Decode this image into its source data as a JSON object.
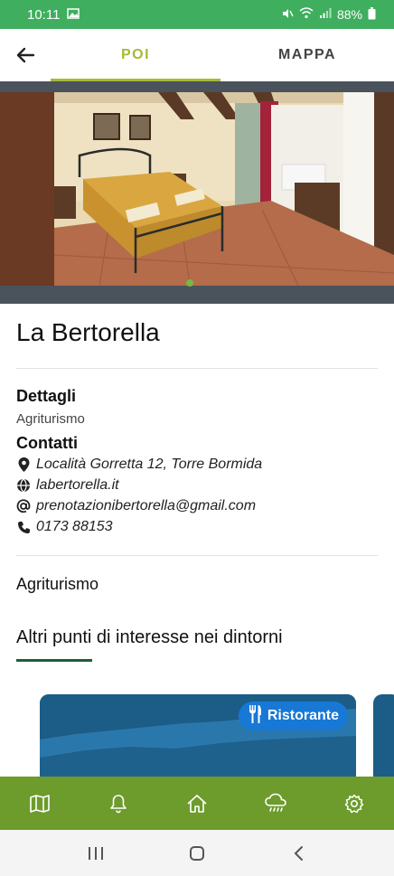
{
  "status_bar": {
    "time": "10:11",
    "battery": "88%"
  },
  "top_nav": {
    "tabs": [
      {
        "label": "POI",
        "active": true
      },
      {
        "label": "MAPPA",
        "active": false
      }
    ]
  },
  "poi": {
    "title": "La Bertorella",
    "details_heading": "Dettagli",
    "details_value": "Agriturismo",
    "contacts_heading": "Contatti",
    "contacts": [
      {
        "icon": "map-pin-icon",
        "text": "Località Gorretta 12, Torre Bormida"
      },
      {
        "icon": "globe-icon",
        "text": "labertorella.it"
      },
      {
        "icon": "at-icon",
        "text": "prenotazionibertorella@gmail.com"
      },
      {
        "icon": "phone-icon",
        "text": "0173 88153"
      }
    ],
    "category": "Agriturismo"
  },
  "nearby": {
    "heading": "Altri punti di interesse nei dintorni",
    "cards": [
      {
        "badge": "Ristorante",
        "badge_icon": "fork-knife-icon"
      }
    ]
  },
  "bottom_nav": {
    "items": [
      "map-icon",
      "bell-icon",
      "home-icon",
      "weather-rain-icon",
      "gear-icon"
    ]
  },
  "colors": {
    "status_bar": "#3fae5e",
    "accent_tab": "#a8b934",
    "bottom_nav": "#6d9b2c",
    "badge": "#1778d6",
    "card": "#1b5d86"
  }
}
